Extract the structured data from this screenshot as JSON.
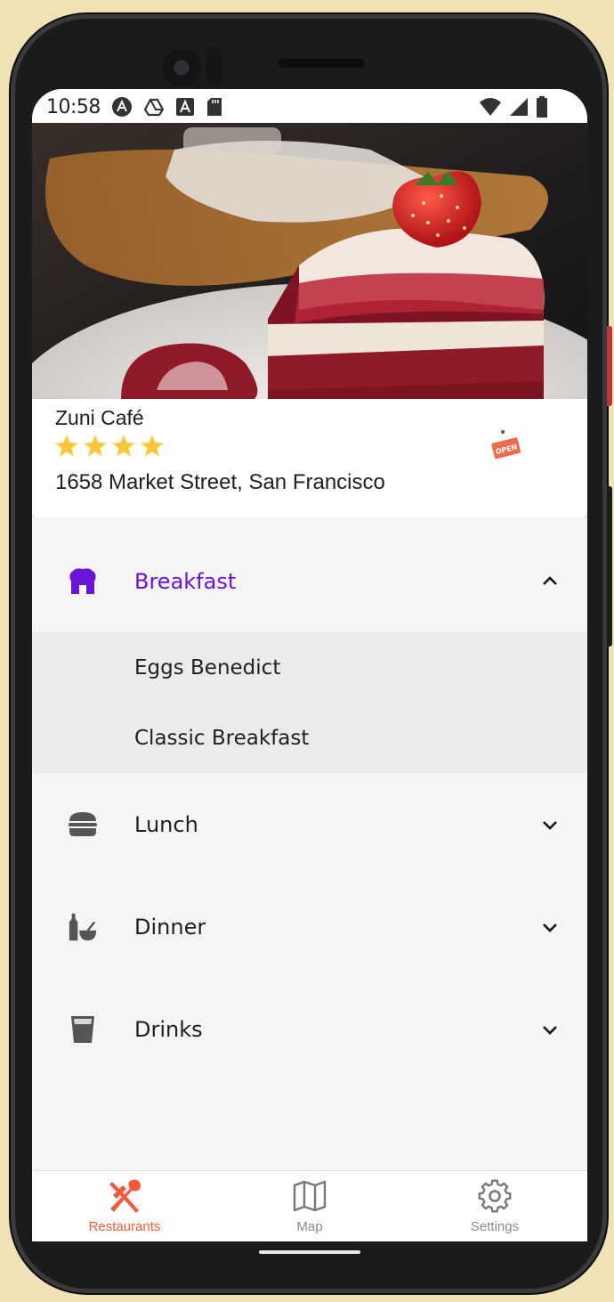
{
  "status_bar": {
    "time": "10:58",
    "icons": [
      "a-circle-icon",
      "drive-icon",
      "font-a-icon",
      "sd-card-icon",
      "wifi-icon",
      "signal-icon",
      "battery-icon"
    ]
  },
  "restaurant": {
    "name": "Zuni Café",
    "rating": 4,
    "rating_max": 4,
    "address": "1658 Market Street, San Francisco",
    "open_sign": "OPEN"
  },
  "menu": {
    "categories": [
      {
        "label": "Breakfast",
        "icon": "chef-hat-icon",
        "expanded": true,
        "items": [
          "Eggs Benedict",
          "Classic Breakfast"
        ]
      },
      {
        "label": "Lunch",
        "icon": "burger-icon",
        "expanded": false
      },
      {
        "label": "Dinner",
        "icon": "bottle-bowl-icon",
        "expanded": false
      },
      {
        "label": "Drinks",
        "icon": "glass-icon",
        "expanded": false
      }
    ]
  },
  "bottom_nav": {
    "tabs": [
      {
        "label": "Restaurants",
        "icon": "fork-knife-icon",
        "active": true
      },
      {
        "label": "Map",
        "icon": "map-icon",
        "active": false
      },
      {
        "label": "Settings",
        "icon": "gear-icon",
        "active": false
      }
    ]
  },
  "colors": {
    "accent": "#6a14d8",
    "nav_active": "#f25a3f",
    "star": "#f7c63a",
    "background": "#efe2b4"
  }
}
